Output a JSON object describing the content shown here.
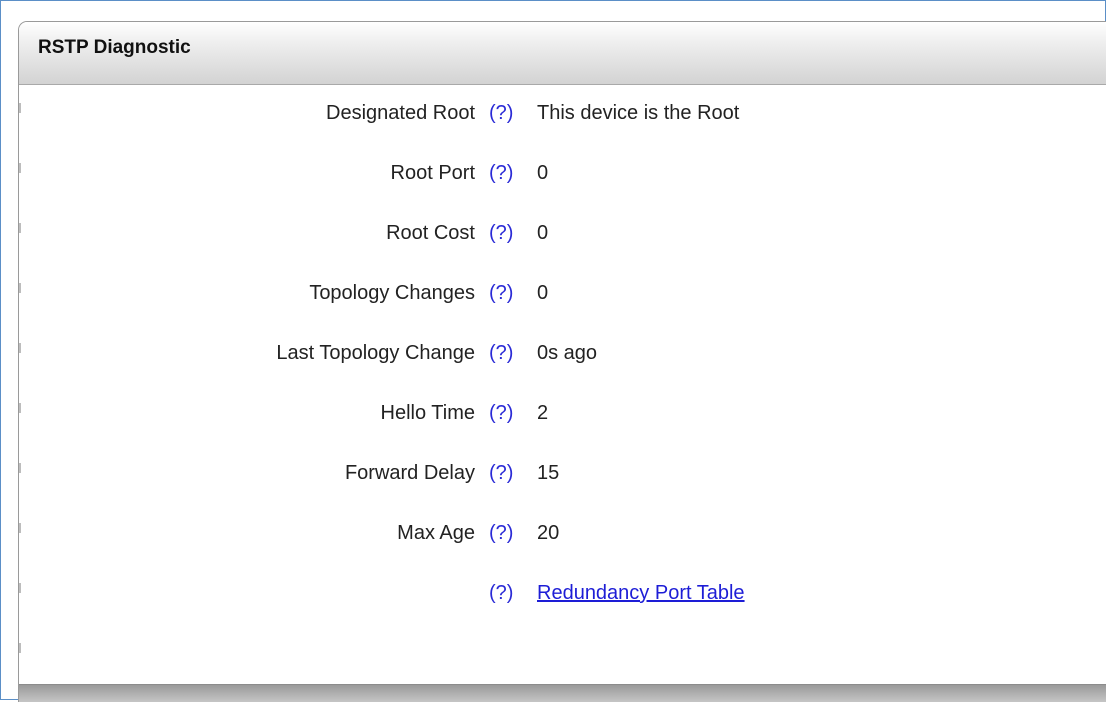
{
  "panel": {
    "title": "RSTP Diagnostic",
    "help_label": "(?)",
    "rows": [
      {
        "label": "Designated Root",
        "value": "This device is the Root"
      },
      {
        "label": "Root Port",
        "value": "0"
      },
      {
        "label": "Root Cost",
        "value": "0"
      },
      {
        "label": "Topology Changes",
        "value": "0"
      },
      {
        "label": "Last Topology Change",
        "value": "0s ago"
      },
      {
        "label": "Hello Time",
        "value": "2"
      },
      {
        "label": "Forward Delay",
        "value": "15"
      },
      {
        "label": "Max Age",
        "value": "20"
      }
    ],
    "link_label": "Redundancy Port Table"
  },
  "colors": {
    "help": "#2a2ad6",
    "link": "#1d1dd6",
    "frame_border": "#5b8fc7"
  }
}
